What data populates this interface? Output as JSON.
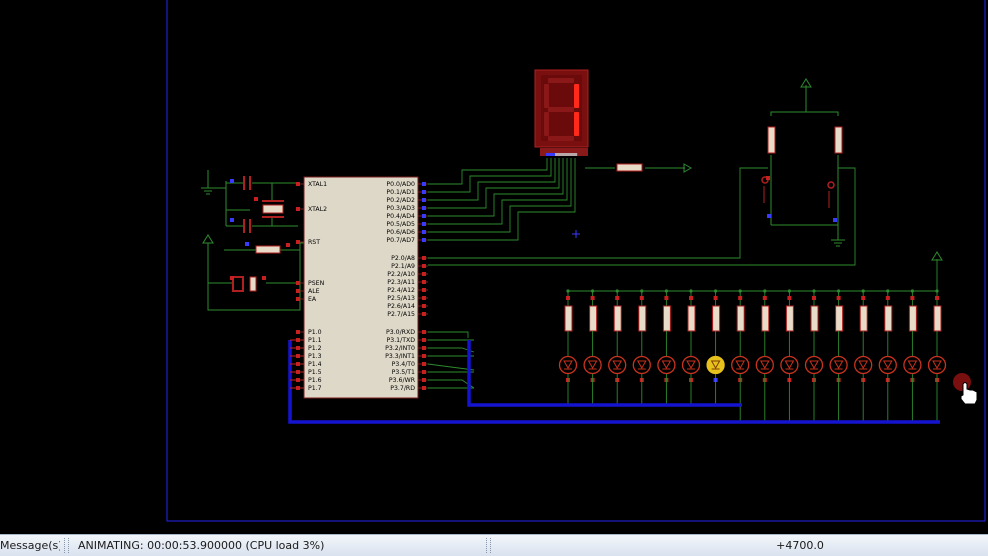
{
  "chip": {
    "left_pins": [
      "XTAL1",
      "XTAL2",
      "RST",
      "PSEN",
      "ALE",
      "EA",
      "P1.0",
      "P1.1",
      "P1.2",
      "P1.3",
      "P1.4",
      "P1.5",
      "P1.6",
      "P1.7"
    ],
    "right_pins": [
      "P0.0/AD0",
      "P0.1/AD1",
      "P0.2/AD2",
      "P0.3/AD3",
      "P0.4/AD4",
      "P0.5/AD5",
      "P0.6/AD6",
      "P0.7/AD7",
      "P2.0/A8",
      "P2.1/A9",
      "P2.2/A10",
      "P2.3/A11",
      "P2.4/A12",
      "P2.5/A13",
      "P2.6/A14",
      "P2.7/A15",
      "P3.0/RXD",
      "P3.1/TXD",
      "P3.2/INT0",
      "P3.3/INT1",
      "P3.4/T0",
      "P3.5/T1",
      "P3.6/WR",
      "P3.7/RD"
    ]
  },
  "seven_segment": {
    "digit": "1",
    "color": "#ff2a1a"
  },
  "led_row": {
    "count": 16,
    "lit_index": 6,
    "lit_color": "#e8c21c",
    "off_color": "#c8321e"
  },
  "colors": {
    "wire": "#2e8b2e",
    "bus": "#1414d0",
    "frame": "#1e1ec8",
    "component": "#b02020"
  },
  "status": {
    "messages": "Message(s)",
    "animation": "ANIMATING: 00:00:53.900000 (CPU load 3%)",
    "coordinate": "+4700.0"
  }
}
